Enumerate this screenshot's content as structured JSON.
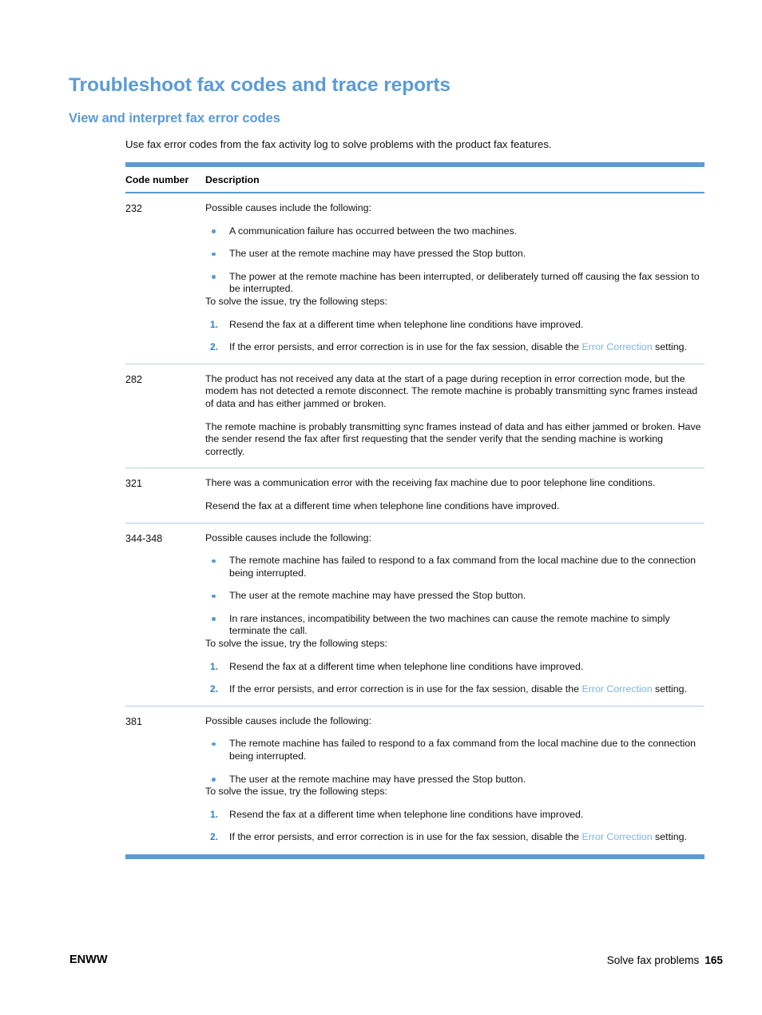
{
  "colors": {
    "heading_blue": "#5b9bd5",
    "rule_blue": "#5b9bd5",
    "link_blue": "#7fb2e0",
    "number_blue": "#2f7fc4",
    "row_divider": "#b9cfe2",
    "text": "#111111"
  },
  "page": {
    "title": "Troubleshoot fax codes and trace reports",
    "section_heading": "View and interpret fax error codes",
    "intro": "Use fax error codes from the fax activity log to solve problems with the product fax features."
  },
  "table": {
    "headers": {
      "code": "Code number",
      "description": "Description"
    },
    "rows": [
      {
        "code": "232",
        "intro": "Possible causes include the following:",
        "bullets": [
          "A communication failure has occurred between the two machines.",
          "The user at the remote machine may have pressed the Stop button.",
          "The power at the remote machine has been interrupted, or deliberately turned off causing the fax session to be interrupted."
        ],
        "steps_intro": "To solve the issue, try the following steps:",
        "steps": [
          {
            "number": "1.",
            "text": "Resend the fax at a different time when telephone line conditions have improved."
          },
          {
            "number": "2.",
            "prefix": "If the error persists, and error correction is in use for the fax session, disable the ",
            "link": "Error Correction",
            "suffix": " setting."
          }
        ]
      },
      {
        "code": "282",
        "paragraphs": [
          "The product has not received any data at the start of a page during reception in error correction mode, but the modem has not detected a remote disconnect. The remote machine is probably transmitting sync frames instead of data and has either jammed or broken.",
          "The remote machine is probably transmitting sync frames instead of data and has either jammed or broken. Have the sender resend the fax after first requesting that the sender verify that the sending machine is working correctly."
        ]
      },
      {
        "code": "321",
        "paragraphs": [
          "There was a communication error with the receiving fax machine due to poor telephone line conditions.",
          "Resend the fax at a different time when telephone line conditions have improved."
        ]
      },
      {
        "code": "344-348",
        "intro": "Possible causes include the following:",
        "bullets": [
          "The remote machine has failed to respond to a fax command from the local machine due to the connection being interrupted.",
          "The user at the remote machine may have pressed the Stop button.",
          "In rare instances, incompatibility between the two machines can cause the remote machine to simply terminate the call."
        ],
        "steps_intro": "To solve the issue, try the following steps:",
        "steps": [
          {
            "number": "1.",
            "text": "Resend the fax at a different time when telephone line conditions have improved."
          },
          {
            "number": "2.",
            "prefix": "If the error persists, and error correction is in use for the fax session, disable the ",
            "link": "Error Correction",
            "suffix": " setting."
          }
        ]
      },
      {
        "code": "381",
        "intro": "Possible causes include the following:",
        "bullets": [
          "The remote machine has failed to respond to a fax command from the local machine due to the connection being interrupted.",
          "The user at the remote machine may have pressed the Stop button."
        ],
        "steps_intro": "To solve the issue, try the following steps:",
        "steps": [
          {
            "number": "1.",
            "text": "Resend the fax at a different time when telephone line conditions have improved."
          },
          {
            "number": "2.",
            "prefix": "If the error persists, and error correction is in use for the fax session, disable the ",
            "link": "Error Correction",
            "suffix": " setting."
          }
        ]
      }
    ]
  },
  "footer": {
    "left": "ENWW",
    "section": "Solve fax problems",
    "page_number": "165"
  }
}
